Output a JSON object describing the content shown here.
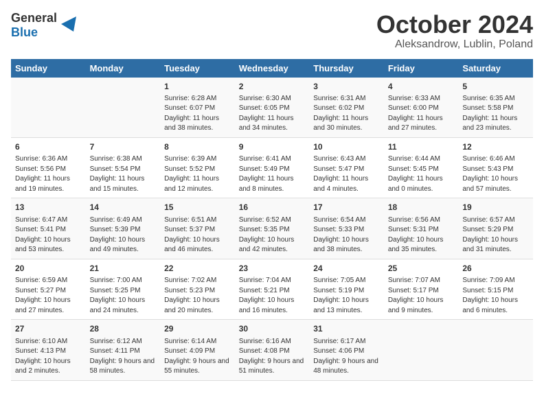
{
  "header": {
    "logo_general": "General",
    "logo_blue": "Blue",
    "month": "October 2024",
    "location": "Aleksandrow, Lublin, Poland"
  },
  "days_of_week": [
    "Sunday",
    "Monday",
    "Tuesday",
    "Wednesday",
    "Thursday",
    "Friday",
    "Saturday"
  ],
  "weeks": [
    [
      {
        "day": "",
        "info": ""
      },
      {
        "day": "",
        "info": ""
      },
      {
        "day": "1",
        "info": "Sunrise: 6:28 AM\nSunset: 6:07 PM\nDaylight: 11 hours and 38 minutes."
      },
      {
        "day": "2",
        "info": "Sunrise: 6:30 AM\nSunset: 6:05 PM\nDaylight: 11 hours and 34 minutes."
      },
      {
        "day": "3",
        "info": "Sunrise: 6:31 AM\nSunset: 6:02 PM\nDaylight: 11 hours and 30 minutes."
      },
      {
        "day": "4",
        "info": "Sunrise: 6:33 AM\nSunset: 6:00 PM\nDaylight: 11 hours and 27 minutes."
      },
      {
        "day": "5",
        "info": "Sunrise: 6:35 AM\nSunset: 5:58 PM\nDaylight: 11 hours and 23 minutes."
      }
    ],
    [
      {
        "day": "6",
        "info": "Sunrise: 6:36 AM\nSunset: 5:56 PM\nDaylight: 11 hours and 19 minutes."
      },
      {
        "day": "7",
        "info": "Sunrise: 6:38 AM\nSunset: 5:54 PM\nDaylight: 11 hours and 15 minutes."
      },
      {
        "day": "8",
        "info": "Sunrise: 6:39 AM\nSunset: 5:52 PM\nDaylight: 11 hours and 12 minutes."
      },
      {
        "day": "9",
        "info": "Sunrise: 6:41 AM\nSunset: 5:49 PM\nDaylight: 11 hours and 8 minutes."
      },
      {
        "day": "10",
        "info": "Sunrise: 6:43 AM\nSunset: 5:47 PM\nDaylight: 11 hours and 4 minutes."
      },
      {
        "day": "11",
        "info": "Sunrise: 6:44 AM\nSunset: 5:45 PM\nDaylight: 11 hours and 0 minutes."
      },
      {
        "day": "12",
        "info": "Sunrise: 6:46 AM\nSunset: 5:43 PM\nDaylight: 10 hours and 57 minutes."
      }
    ],
    [
      {
        "day": "13",
        "info": "Sunrise: 6:47 AM\nSunset: 5:41 PM\nDaylight: 10 hours and 53 minutes."
      },
      {
        "day": "14",
        "info": "Sunrise: 6:49 AM\nSunset: 5:39 PM\nDaylight: 10 hours and 49 minutes."
      },
      {
        "day": "15",
        "info": "Sunrise: 6:51 AM\nSunset: 5:37 PM\nDaylight: 10 hours and 46 minutes."
      },
      {
        "day": "16",
        "info": "Sunrise: 6:52 AM\nSunset: 5:35 PM\nDaylight: 10 hours and 42 minutes."
      },
      {
        "day": "17",
        "info": "Sunrise: 6:54 AM\nSunset: 5:33 PM\nDaylight: 10 hours and 38 minutes."
      },
      {
        "day": "18",
        "info": "Sunrise: 6:56 AM\nSunset: 5:31 PM\nDaylight: 10 hours and 35 minutes."
      },
      {
        "day": "19",
        "info": "Sunrise: 6:57 AM\nSunset: 5:29 PM\nDaylight: 10 hours and 31 minutes."
      }
    ],
    [
      {
        "day": "20",
        "info": "Sunrise: 6:59 AM\nSunset: 5:27 PM\nDaylight: 10 hours and 27 minutes."
      },
      {
        "day": "21",
        "info": "Sunrise: 7:00 AM\nSunset: 5:25 PM\nDaylight: 10 hours and 24 minutes."
      },
      {
        "day": "22",
        "info": "Sunrise: 7:02 AM\nSunset: 5:23 PM\nDaylight: 10 hours and 20 minutes."
      },
      {
        "day": "23",
        "info": "Sunrise: 7:04 AM\nSunset: 5:21 PM\nDaylight: 10 hours and 16 minutes."
      },
      {
        "day": "24",
        "info": "Sunrise: 7:05 AM\nSunset: 5:19 PM\nDaylight: 10 hours and 13 minutes."
      },
      {
        "day": "25",
        "info": "Sunrise: 7:07 AM\nSunset: 5:17 PM\nDaylight: 10 hours and 9 minutes."
      },
      {
        "day": "26",
        "info": "Sunrise: 7:09 AM\nSunset: 5:15 PM\nDaylight: 10 hours and 6 minutes."
      }
    ],
    [
      {
        "day": "27",
        "info": "Sunrise: 6:10 AM\nSunset: 4:13 PM\nDaylight: 10 hours and 2 minutes."
      },
      {
        "day": "28",
        "info": "Sunrise: 6:12 AM\nSunset: 4:11 PM\nDaylight: 9 hours and 58 minutes."
      },
      {
        "day": "29",
        "info": "Sunrise: 6:14 AM\nSunset: 4:09 PM\nDaylight: 9 hours and 55 minutes."
      },
      {
        "day": "30",
        "info": "Sunrise: 6:16 AM\nSunset: 4:08 PM\nDaylight: 9 hours and 51 minutes."
      },
      {
        "day": "31",
        "info": "Sunrise: 6:17 AM\nSunset: 4:06 PM\nDaylight: 9 hours and 48 minutes."
      },
      {
        "day": "",
        "info": ""
      },
      {
        "day": "",
        "info": ""
      }
    ]
  ]
}
